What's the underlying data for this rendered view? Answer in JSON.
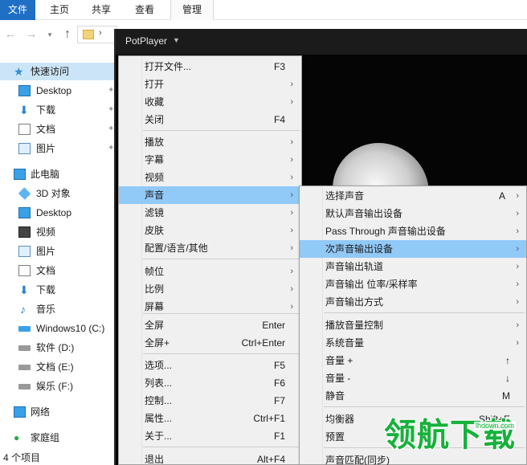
{
  "ribbon": {
    "tabs": [
      "文件",
      "主页",
      "共享",
      "查看",
      "管理"
    ]
  },
  "nav": {
    "quick_access": "快速访问",
    "quick_items": [
      "Desktop",
      "下载",
      "文档",
      "图片"
    ],
    "this_pc": "此电脑",
    "pc_items": [
      "3D 对象",
      "Desktop",
      "视频",
      "图片",
      "文档",
      "下载",
      "音乐",
      "Windows10 (C:)",
      "软件 (D:)",
      "文档 (E:)",
      "娱乐 (F:)"
    ],
    "network": "网络",
    "homegroup": "家庭组"
  },
  "status": {
    "count": "4 个项目"
  },
  "potplayer": {
    "title": "PotPlayer"
  },
  "main_menu": [
    {
      "label": "打开文件...",
      "shortcut": "F3",
      "arrow": false
    },
    {
      "label": "打开",
      "shortcut": "",
      "arrow": true
    },
    {
      "label": "收藏",
      "shortcut": "",
      "arrow": true
    },
    {
      "label": "关闭",
      "shortcut": "F4",
      "arrow": false
    },
    {
      "label": "播放",
      "shortcut": "",
      "arrow": true
    },
    {
      "label": "字幕",
      "shortcut": "",
      "arrow": true
    },
    {
      "label": "视频",
      "shortcut": "",
      "arrow": true
    },
    {
      "label": "声音",
      "shortcut": "",
      "arrow": true
    },
    {
      "label": "滤镜",
      "shortcut": "",
      "arrow": true
    },
    {
      "label": "皮肤",
      "shortcut": "",
      "arrow": true
    },
    {
      "label": "配置/语言/其他",
      "shortcut": "",
      "arrow": true
    },
    {
      "label": "帧位",
      "shortcut": "",
      "arrow": true
    },
    {
      "label": "比例",
      "shortcut": "",
      "arrow": true
    },
    {
      "label": "屏幕",
      "shortcut": "",
      "arrow": true
    },
    {
      "label": "全屏",
      "shortcut": "Enter",
      "arrow": false
    },
    {
      "label": "全屏+",
      "shortcut": "Ctrl+Enter",
      "arrow": false
    },
    {
      "label": "选项...",
      "shortcut": "F5",
      "arrow": false
    },
    {
      "label": "列表...",
      "shortcut": "F6",
      "arrow": false
    },
    {
      "label": "控制...",
      "shortcut": "F7",
      "arrow": false
    },
    {
      "label": "属性...",
      "shortcut": "Ctrl+F1",
      "arrow": false
    },
    {
      "label": "关于...",
      "shortcut": "F1",
      "arrow": false
    },
    {
      "label": "退出",
      "shortcut": "Alt+F4",
      "arrow": false
    }
  ],
  "sound_menu": [
    {
      "label": "选择声音",
      "shortcut": "A",
      "arrow": true
    },
    {
      "label": "默认声音输出设备",
      "shortcut": "",
      "arrow": true
    },
    {
      "label": "Pass Through 声音输出设备",
      "shortcut": "",
      "arrow": true
    },
    {
      "label": "次声音输出设备",
      "shortcut": "",
      "arrow": true
    },
    {
      "label": "声音输出轨道",
      "shortcut": "",
      "arrow": true
    },
    {
      "label": "声音输出 位率/采样率",
      "shortcut": "",
      "arrow": true
    },
    {
      "label": "声音输出方式",
      "shortcut": "",
      "arrow": true
    },
    {
      "label": "播放音量控制",
      "shortcut": "",
      "arrow": true
    },
    {
      "label": "系统音量",
      "shortcut": "",
      "arrow": true
    },
    {
      "label": "音量 +",
      "shortcut": "↑",
      "arrow": false
    },
    {
      "label": "音量 -",
      "shortcut": "↓",
      "arrow": false
    },
    {
      "label": "静音",
      "shortcut": "M",
      "arrow": false
    },
    {
      "label": "均衡器",
      "shortcut": "Shift+E",
      "arrow": false
    },
    {
      "label": "预置",
      "shortcut": "",
      "arrow": false
    },
    {
      "label": "声音匹配(同步)",
      "shortcut": "",
      "arrow": false
    }
  ],
  "watermark": {
    "text": "领航下载",
    "url": "lhdown.com"
  },
  "colors": {
    "highlight": "#91c9f7",
    "ribbon_file": "#1f6fc5",
    "watermark": "#17b13b"
  }
}
